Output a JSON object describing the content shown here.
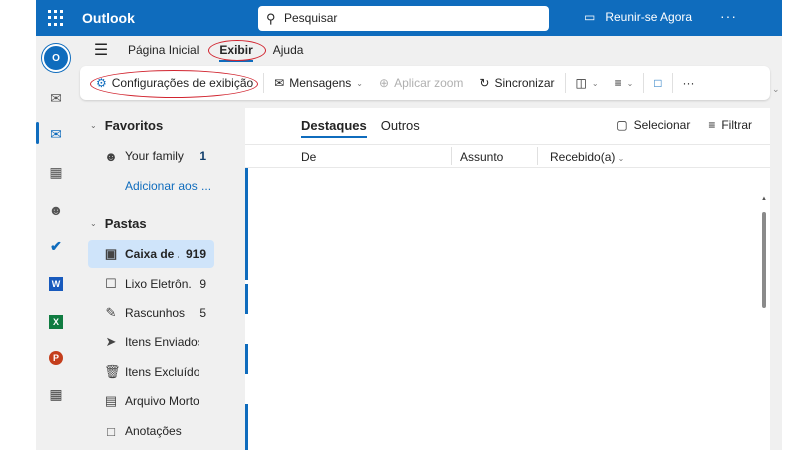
{
  "topbar": {
    "app_name": "Outlook",
    "search_placeholder": "Pesquisar",
    "meet_label": "Reunir-se Agora",
    "more": "···",
    "accent": "#0f6cbd"
  },
  "tabs": [
    {
      "label": "Página Inicial"
    },
    {
      "label": "Exibir",
      "active": true
    },
    {
      "label": "Ajuda"
    }
  ],
  "ribbon": {
    "view_settings": "Configurações de exibição",
    "messages": "Mensagens",
    "zoom": "Aplicar zoom",
    "sync": "Sincronizar",
    "more": "···"
  },
  "rail": [
    "new-mail-icon",
    "mail-icon",
    "calendar-icon",
    "people-icon",
    "todo-icon",
    "word-icon",
    "excel-icon",
    "powerpoint-icon",
    "apps-icon"
  ],
  "favorites": {
    "title": "Favoritos",
    "items": [
      {
        "label": "Your family",
        "count": "1"
      }
    ],
    "add": "Adicionar aos ..."
  },
  "folders": {
    "title": "Pastas",
    "items": [
      {
        "label": "Caixa de ...",
        "count": "919",
        "icon": "inbox-icon"
      },
      {
        "label": "Lixo Eletrôn...",
        "count": "9",
        "icon": "junk-icon"
      },
      {
        "label": "Rascunhos",
        "count": "5",
        "icon": "drafts-icon"
      },
      {
        "label": "Itens Enviados",
        "count": "",
        "icon": "sent-icon"
      },
      {
        "label": "Itens Excluídos",
        "count": "",
        "icon": "trash-icon"
      },
      {
        "label": "Arquivo Morto",
        "count": "",
        "icon": "archive-icon"
      },
      {
        "label": "Anotações",
        "count": "",
        "icon": "notes-icon"
      }
    ]
  },
  "list": {
    "tabs": [
      "Destaques",
      "Outros"
    ],
    "select": "Selecionar",
    "filter": "Filtrar",
    "columns": [
      "De",
      "Assunto",
      "Recebido(a)"
    ]
  }
}
